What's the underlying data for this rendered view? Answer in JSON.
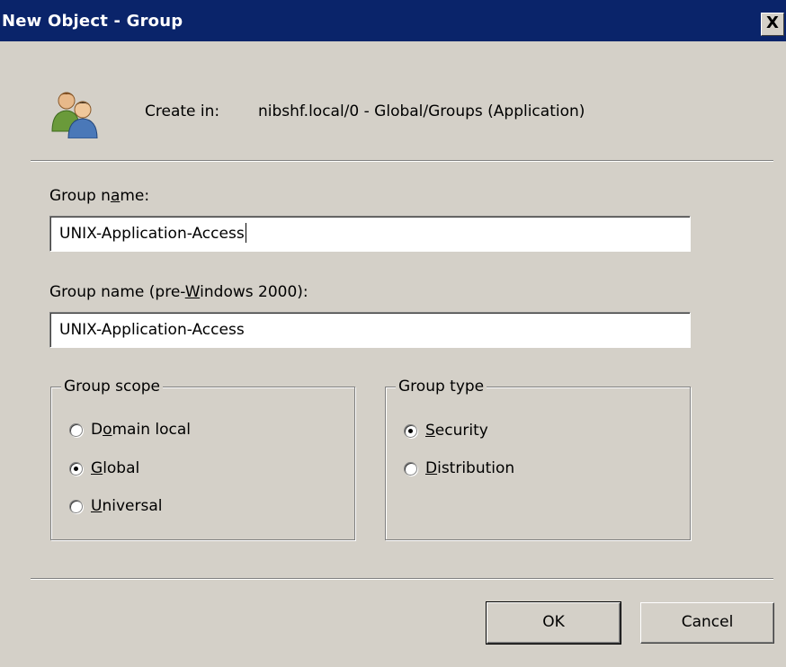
{
  "window": {
    "title": "New Object - Group",
    "close_label": "X"
  },
  "header": {
    "icon": "group-users-icon",
    "create_in_label": "Create in:",
    "create_in_path": "nibshf.local/0 - Global/Groups (Application)"
  },
  "form": {
    "group_name": {
      "label_pre": "Group n",
      "label_accel": "a",
      "label_post": "me:",
      "value": "UNIX-Application-Access"
    },
    "group_name_prewin": {
      "label_pre": "Group name (pre-",
      "label_accel": "W",
      "label_post": "indows 2000):",
      "value": "UNIX-Application-Access"
    }
  },
  "group_scope": {
    "legend": "Group scope",
    "options": [
      {
        "pre": "D",
        "accel": "o",
        "post": "main local",
        "checked": false
      },
      {
        "pre": "",
        "accel": "G",
        "post": "lobal",
        "checked": true
      },
      {
        "pre": "",
        "accel": "U",
        "post": "niversal",
        "checked": false
      }
    ]
  },
  "group_type": {
    "legend": "Group type",
    "options": [
      {
        "pre": "",
        "accel": "S",
        "post": "ecurity",
        "checked": true
      },
      {
        "pre": "",
        "accel": "D",
        "post": "istribution",
        "checked": false
      }
    ]
  },
  "buttons": {
    "ok": "OK",
    "cancel": "Cancel"
  },
  "colors": {
    "titlebar": "#0a246a",
    "face": "#d4d0c8"
  }
}
